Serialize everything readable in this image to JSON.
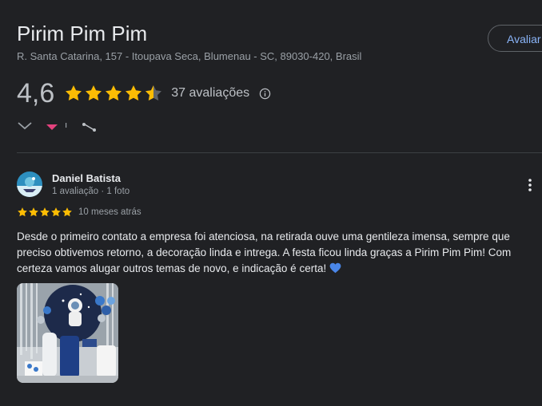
{
  "place": {
    "name": "Pirim Pim Pim",
    "address": "R. Santa Catarina, 157 - Itoupava Seca, Blumenau - SC, 89030-420, Brasil",
    "review_button_label": "Avaliar",
    "rating": "4,6",
    "stars_value": 4.6,
    "reviews_count": "37 avaliações"
  },
  "review": {
    "author": "Daniel Batista",
    "meta": "1 avaliação · 1 foto",
    "stars": 5,
    "date": "10 meses atrás",
    "text": "Desde o primeiro contato a empresa foi atenciosa, na retirada ouve uma gentileza imensa, sempre que preciso obtivemos retorno, a decoração linda e intrega. A festa ficou linda graças a Pirim Pim Pim! Com certeza vamos alugar outros temas de novo, e indicação é certa!"
  },
  "colors": {
    "background": "#202124",
    "star": "#fbbc04",
    "link": "#8ab4f8",
    "heart": "#4a86e8"
  }
}
